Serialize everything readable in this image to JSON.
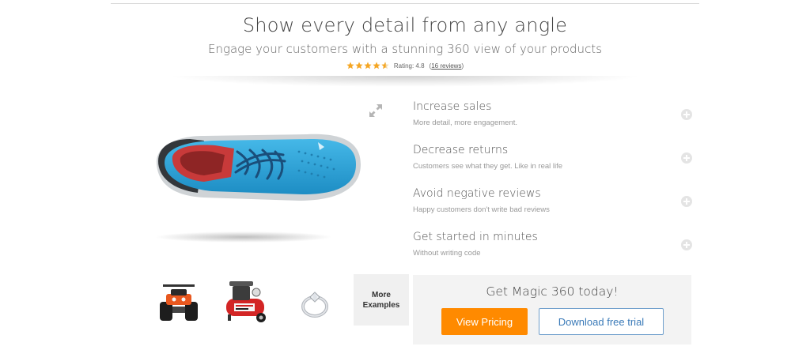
{
  "hero": {
    "title": "Show every detail from any angle",
    "subtitle": "Engage your customers with a stunning 360 view of your products",
    "rating": {
      "stars": 4.8,
      "label": "Rating: 4.8",
      "reviews_link": "16 reviews",
      "open_paren": "(",
      "close_paren": ")"
    }
  },
  "viewer": {
    "product": "blue running shoe",
    "expand_icon": "expand-arrows-icon"
  },
  "thumbnails": {
    "items": [
      {
        "name": "quad-bike"
      },
      {
        "name": "air-compressor"
      },
      {
        "name": "diamond-ring"
      }
    ],
    "more_label_line1": "More",
    "more_label_line2": "Examples"
  },
  "features": [
    {
      "title": "Increase sales",
      "subtitle": "More detail, more engagement."
    },
    {
      "title": "Decrease returns",
      "subtitle": "Customers see what they get. Like in real life"
    },
    {
      "title": "Avoid negative reviews",
      "subtitle": "Happy customers don't write bad reviews"
    },
    {
      "title": "Get started in minutes",
      "subtitle": "Without writing code"
    }
  ],
  "cta": {
    "title": "Get Magic 360 today!",
    "pricing_label": "View Pricing",
    "trial_label": "Download free trial"
  },
  "colors": {
    "accent": "#ff8a00",
    "link_blue": "#3a7ab8",
    "star": "#f5a623"
  }
}
